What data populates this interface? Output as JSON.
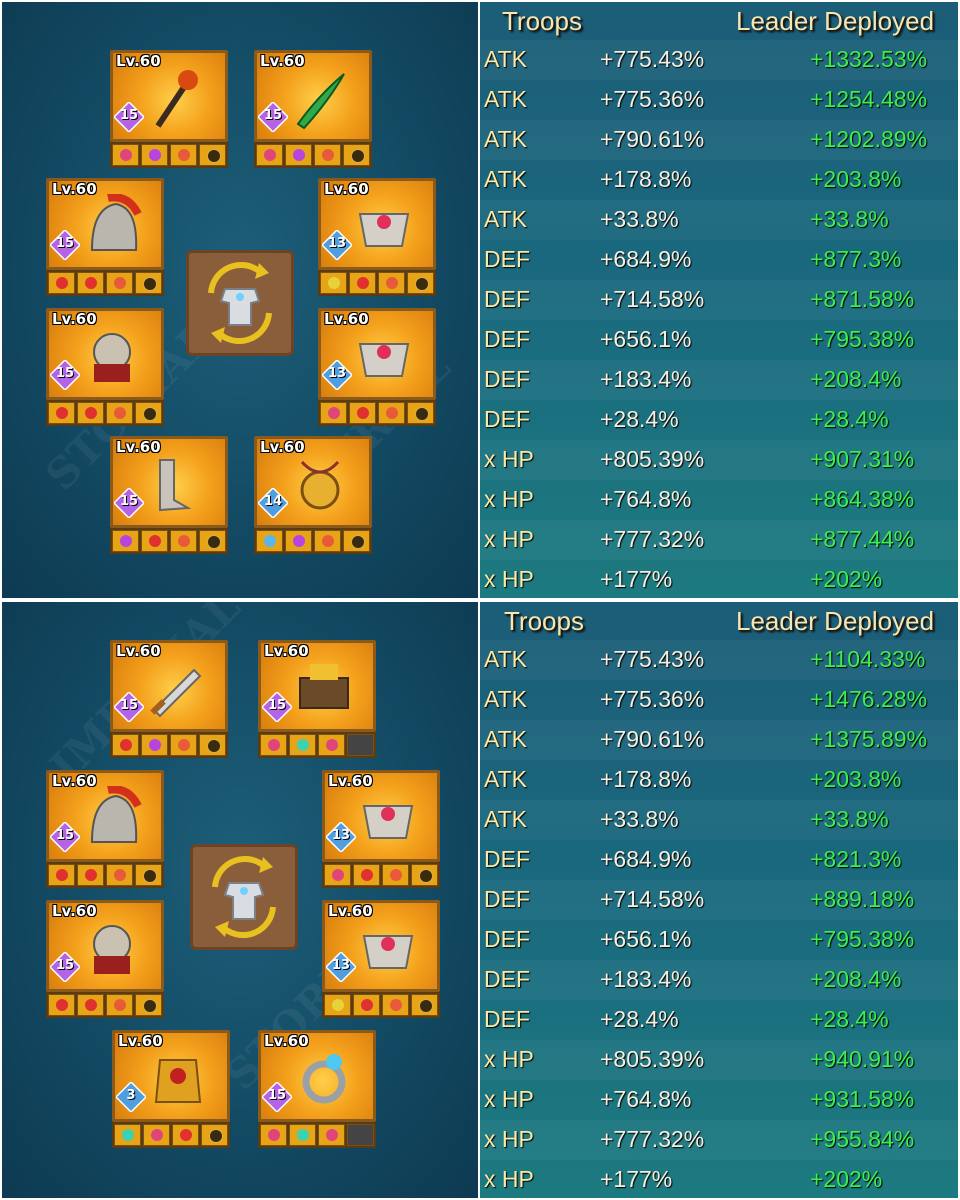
{
  "screens": [
    {
      "slots": [
        {
          "level": "Lv.60",
          "stars": "15",
          "star": "purple",
          "item": "staff",
          "gems": [
            "#e0447a",
            "#b844e0",
            "#e85a3a",
            "icon"
          ]
        },
        {
          "level": "Lv.60",
          "stars": "15",
          "star": "purple",
          "item": "blade",
          "gems": [
            "#e0447a",
            "#b844e0",
            "#e85a3a",
            "icon"
          ]
        },
        {
          "level": "Lv.60",
          "stars": "15",
          "star": "purple",
          "item": "helmet",
          "gems": [
            "#e03030",
            "#e03030",
            "#e85a3a",
            "icon"
          ]
        },
        {
          "level": "Lv.60",
          "stars": "13",
          "star": "blue",
          "item": "chest",
          "gems": [
            "#e8d23a",
            "#e03030",
            "#e85a3a",
            "icon"
          ]
        },
        {
          "level": "Lv.60",
          "stars": "15",
          "star": "purple",
          "item": "helmet2",
          "gems": [
            "#e03030",
            "#e03030",
            "#e85a3a",
            "icon"
          ]
        },
        {
          "level": "Lv.60",
          "stars": "13",
          "star": "blue",
          "item": "chest",
          "gems": [
            "#e0447a",
            "#e03030",
            "#e85a3a",
            "icon"
          ]
        },
        {
          "level": "Lv.60",
          "stars": "15",
          "star": "purple",
          "item": "boots",
          "gems": [
            "#b844e0",
            "#e03030",
            "#e85a3a",
            "icon"
          ]
        },
        {
          "level": "Lv.60",
          "stars": "14",
          "star": "blue",
          "item": "amulet",
          "gems": [
            "#5ab6e8",
            "#b844e0",
            "#e85a3a",
            "icon"
          ]
        }
      ],
      "stats": {
        "header_troops": "Troops",
        "header_leader": "Leader Deployed",
        "rows": [
          {
            "label": "ATK",
            "troops": "+775.43%",
            "leader": "+1332.53%"
          },
          {
            "label": "ATK",
            "troops": "+775.36%",
            "leader": "+1254.48%"
          },
          {
            "label": "ATK",
            "troops": "+790.61%",
            "leader": "+1202.89%"
          },
          {
            "label": "ATK",
            "troops": "+178.8%",
            "leader": "+203.8%"
          },
          {
            "label": "ATK",
            "troops": "+33.8%",
            "leader": "+33.8%"
          },
          {
            "label": "DEF",
            "troops": "+684.9%",
            "leader": "+877.3%"
          },
          {
            "label": "DEF",
            "troops": "+714.58%",
            "leader": "+871.58%"
          },
          {
            "label": "DEF",
            "troops": "+656.1%",
            "leader": "+795.38%"
          },
          {
            "label": "DEF",
            "troops": "+183.4%",
            "leader": "+208.4%"
          },
          {
            "label": "DEF",
            "troops": "+28.4%",
            "leader": "+28.4%"
          },
          {
            "label": "x HP",
            "troops": "+805.39%",
            "leader": "+907.31%"
          },
          {
            "label": "x HP",
            "troops": "+764.8%",
            "leader": "+864.38%"
          },
          {
            "label": "x HP",
            "troops": "+777.32%",
            "leader": "+877.44%"
          },
          {
            "label": "x HP",
            "troops": "+177%",
            "leader": "+202%"
          }
        ]
      }
    },
    {
      "slots": [
        {
          "level": "Lv.60",
          "stars": "15",
          "star": "purple",
          "item": "sword",
          "gems": [
            "#e03030",
            "#b844e0",
            "#e85a3a",
            "icon"
          ]
        },
        {
          "level": "Lv.60",
          "stars": "15",
          "star": "purple",
          "item": "book",
          "gems": [
            "#e0447a",
            "#3ad2b0",
            "#e0447a",
            "empty"
          ]
        },
        {
          "level": "Lv.60",
          "stars": "15",
          "star": "purple",
          "item": "helmet",
          "gems": [
            "#e03030",
            "#e03030",
            "#e85a3a",
            "icon"
          ]
        },
        {
          "level": "Lv.60",
          "stars": "13",
          "star": "blue",
          "item": "chest",
          "gems": [
            "#e0447a",
            "#e03030",
            "#e85a3a",
            "icon"
          ]
        },
        {
          "level": "Lv.60",
          "stars": "15",
          "star": "purple",
          "item": "helmet2",
          "gems": [
            "#e03030",
            "#e03030",
            "#e85a3a",
            "icon"
          ]
        },
        {
          "level": "Lv.60",
          "stars": "13",
          "star": "blue",
          "item": "chest",
          "gems": [
            "#e8d23a",
            "#e03030",
            "#e85a3a",
            "icon"
          ]
        },
        {
          "level": "Lv.60",
          "stars": "3",
          "star": "blue",
          "item": "armor",
          "gems": [
            "#3ad2b0",
            "#e0447a",
            "#e03030",
            "icon"
          ]
        },
        {
          "level": "Lv.60",
          "stars": "15",
          "star": "purple",
          "item": "ring",
          "gems": [
            "#e0447a",
            "#3ad2b0",
            "#e0447a",
            "empty"
          ]
        }
      ],
      "stats": {
        "header_troops": "Troops",
        "header_leader": "Leader Deployed",
        "rows": [
          {
            "label": "ATK",
            "troops": "+775.43%",
            "leader": "+1104.33%"
          },
          {
            "label": "ATK",
            "troops": "+775.36%",
            "leader": "+1476.28%"
          },
          {
            "label": "ATK",
            "troops": "+790.61%",
            "leader": "+1375.89%"
          },
          {
            "label": "ATK",
            "troops": "+178.8%",
            "leader": "+203.8%"
          },
          {
            "label": "ATK",
            "troops": "+33.8%",
            "leader": "+33.8%"
          },
          {
            "label": "DEF",
            "troops": "+684.9%",
            "leader": "+821.3%"
          },
          {
            "label": "DEF",
            "troops": "+714.58%",
            "leader": "+889.18%"
          },
          {
            "label": "DEF",
            "troops": "+656.1%",
            "leader": "+795.38%"
          },
          {
            "label": "DEF",
            "troops": "+183.4%",
            "leader": "+208.4%"
          },
          {
            "label": "DEF",
            "troops": "+28.4%",
            "leader": "+28.4%"
          },
          {
            "label": "x HP",
            "troops": "+805.39%",
            "leader": "+940.91%"
          },
          {
            "label": "x HP",
            "troops": "+764.8%",
            "leader": "+931.58%"
          },
          {
            "label": "x HP",
            "troops": "+777.32%",
            "leader": "+955.84%"
          },
          {
            "label": "x HP",
            "troops": "+177%",
            "leader": "+202%"
          }
        ]
      }
    }
  ],
  "colors": {
    "leader_green": "#3af04c",
    "troops_white": "#f5f0e0",
    "label_gold": "#fbe9a6",
    "header_cream": "#f3e7b8"
  },
  "icons": {
    "swap": "swap-gear-icon",
    "star_badge": "star-badge-icon"
  }
}
